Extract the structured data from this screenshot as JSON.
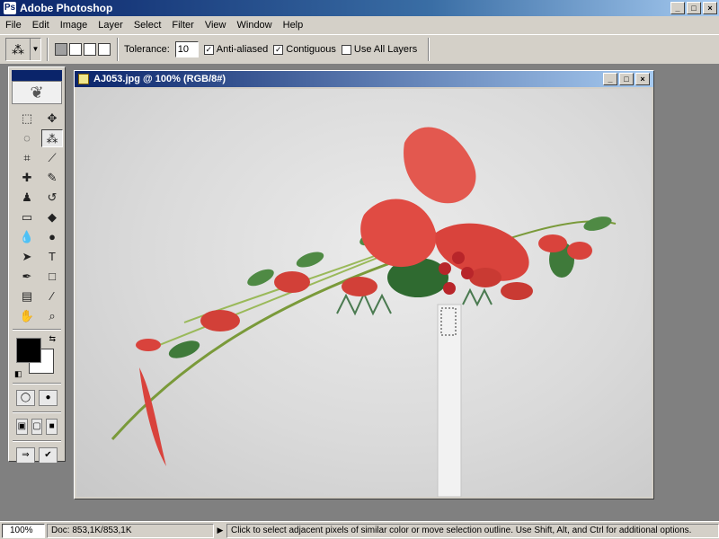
{
  "app": {
    "title": "Adobe Photoshop",
    "window_buttons": [
      "_",
      "□",
      "×"
    ]
  },
  "menu": [
    "File",
    "Edit",
    "Image",
    "Layer",
    "Select",
    "Filter",
    "View",
    "Window",
    "Help"
  ],
  "options": {
    "tool_icon": "magic-wand-icon",
    "tolerance_label": "Tolerance:",
    "tolerance_value": "10",
    "anti_aliased_label": "Anti-aliased",
    "anti_aliased_checked": true,
    "contiguous_label": "Contiguous",
    "contiguous_checked": true,
    "use_all_layers_label": "Use All Layers",
    "use_all_layers_checked": false
  },
  "toolbox": {
    "tools": [
      {
        "name": "marquee-icon",
        "glyph": "⬚"
      },
      {
        "name": "move-icon",
        "glyph": "✥"
      },
      {
        "name": "lasso-icon",
        "glyph": "◌"
      },
      {
        "name": "magic-wand-icon",
        "glyph": "⁂",
        "active": true
      },
      {
        "name": "crop-icon",
        "glyph": "⌗"
      },
      {
        "name": "slice-icon",
        "glyph": "⟋"
      },
      {
        "name": "healing-brush-icon",
        "glyph": "✚"
      },
      {
        "name": "brush-icon",
        "glyph": "✎"
      },
      {
        "name": "clone-stamp-icon",
        "glyph": "♟"
      },
      {
        "name": "history-brush-icon",
        "glyph": "↺"
      },
      {
        "name": "eraser-icon",
        "glyph": "▭"
      },
      {
        "name": "paint-bucket-icon",
        "glyph": "◆"
      },
      {
        "name": "blur-icon",
        "glyph": "💧"
      },
      {
        "name": "dodge-icon",
        "glyph": "●"
      },
      {
        "name": "path-selection-icon",
        "glyph": "➤"
      },
      {
        "name": "type-icon",
        "glyph": "T"
      },
      {
        "name": "pen-icon",
        "glyph": "✒"
      },
      {
        "name": "rectangle-icon",
        "glyph": "□"
      },
      {
        "name": "notes-icon",
        "glyph": "▤"
      },
      {
        "name": "eyedropper-icon",
        "glyph": "⁄"
      },
      {
        "name": "hand-icon",
        "glyph": "✋"
      },
      {
        "name": "zoom-icon",
        "glyph": "⌕"
      }
    ],
    "foreground_color": "#000000",
    "background_color": "#ffffff"
  },
  "document": {
    "title": "AJ053.jpg @ 100% (RGB/8#)",
    "window_buttons": [
      "_",
      "□",
      "×"
    ]
  },
  "status": {
    "zoom": "100%",
    "doc_info": "Doc: 853,1K/853,1K",
    "hint": "Click to select adjacent pixels of similar color or move selection outline.  Use Shift, Alt, and Ctrl for additional options."
  },
  "colors": {
    "title_bar": "#0a246a",
    "chrome": "#d4d0c8",
    "workspace": "#808080",
    "flower_red": "#d9433c",
    "leaf_green": "#3f7a3a"
  }
}
